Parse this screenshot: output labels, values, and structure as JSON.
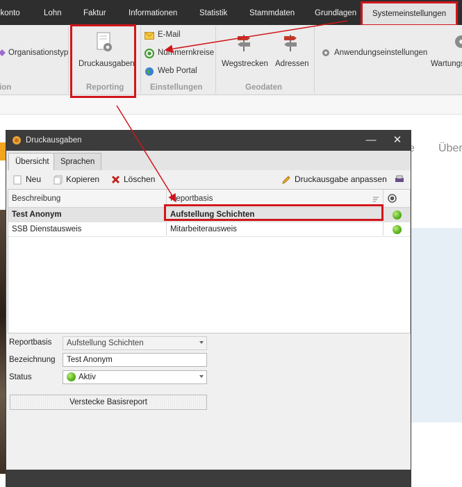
{
  "menubar": {
    "items": [
      "lkonto",
      "Lohn",
      "Faktur",
      "Informationen",
      "Statistik",
      "Stammdaten",
      "Grundlagen"
    ],
    "active": "Systemeinstellungen"
  },
  "ribbon": {
    "organisationstyp": "Organisationstyp",
    "group_ion": "ion",
    "druckausgaben": "Druckausgaben",
    "group_reporting": "Reporting",
    "email": "E-Mail",
    "nummernkreise": "Nummernkreise",
    "webportal": "Web Portal",
    "group_einstellungen": "Einstellungen",
    "wegstrecken": "Wegstrecken",
    "adressen": "Adressen",
    "group_geodaten": "Geodaten",
    "anwendungseinstellungen": "Anwendungseinstellungen",
    "wartung": "Wartungs"
  },
  "background": {
    "text_e": "e",
    "text_uber": "Über"
  },
  "dialog": {
    "title": "Druckausgaben",
    "close": "✕",
    "minimize": "—",
    "tabs": [
      "Übersicht",
      "Sprachen"
    ],
    "toolbar": {
      "neu": "Neu",
      "kopieren": "Kopieren",
      "loeschen": "Löschen",
      "anpassen": "Druckausgabe anpassen"
    },
    "grid": {
      "columns": [
        "Beschreibung",
        "Reportbasis"
      ],
      "rows": [
        {
          "beschreibung": "Test Anonym",
          "reportbasis": "Aufstellung Schichten",
          "status": "green"
        },
        {
          "beschreibung": "SSB Dienstausweis",
          "reportbasis": "Mitarbeiterausweis",
          "status": "green"
        }
      ]
    },
    "form": {
      "reportbasis_label": "Reportbasis",
      "reportbasis_value": "Aufstellung Schichten",
      "bezeichnung_label": "Bezeichnung",
      "bezeichnung_value": "Test Anonym",
      "status_label": "Status",
      "status_value": "Aktiv",
      "button": "Verstecke Basisreport"
    }
  },
  "colors": {
    "highlight": "#d0161b",
    "dark": "#2e2e2e",
    "ribbon": "#ececec",
    "status_green": "#56b21a"
  }
}
